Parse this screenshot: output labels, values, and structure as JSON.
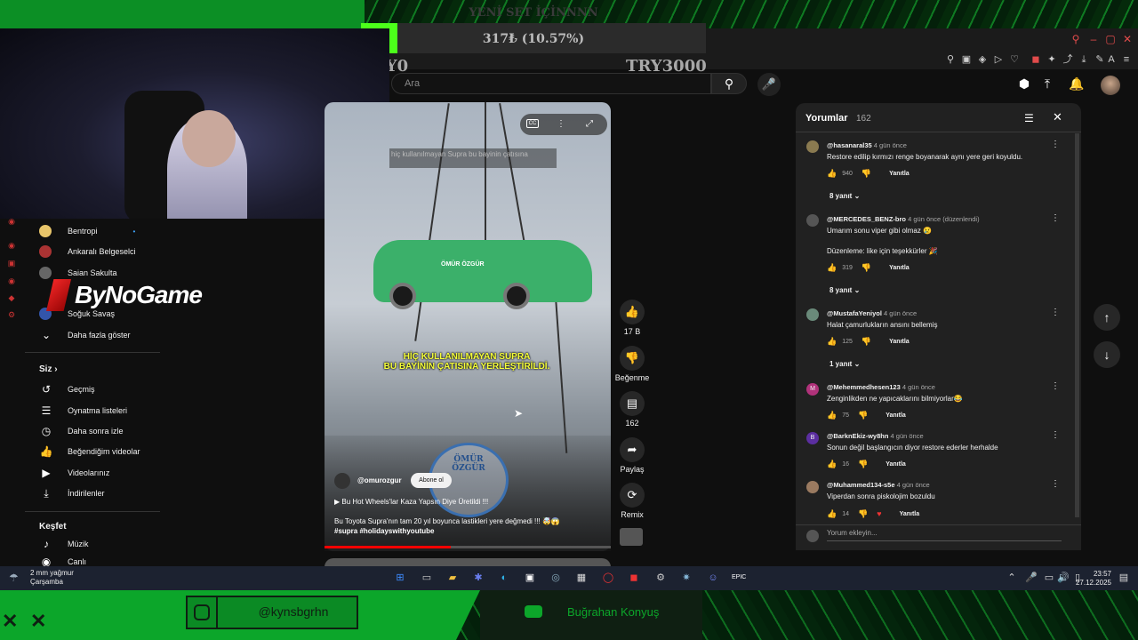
{
  "overlay": {
    "set_title": "YENİ SET İÇİNNNN",
    "donation_text": "317₺ (10.57%)",
    "donation_progress_percent": 10.57,
    "try_min": "TRY0",
    "try_max": "TRY3000",
    "instagram": "@kynsbgrhn",
    "youtube_name": "Buğrahan Konyuş",
    "logo": "ByNoGame"
  },
  "header": {
    "search_placeholder": "Ara"
  },
  "sidebar": {
    "subscriptions": [
      {
        "label": "Bentropi"
      },
      {
        "label": "Ankaralı Belgeselci"
      },
      {
        "label": "Saian Sakulta"
      },
      {
        "label": "Soğuk Savaş"
      }
    ],
    "show_more": "Daha fazla göster",
    "you_heading": "Siz",
    "you_items": [
      {
        "label": "Geçmiş",
        "icon": "history-icon"
      },
      {
        "label": "Oynatma listeleri",
        "icon": "playlist-icon"
      },
      {
        "label": "Daha sonra izle",
        "icon": "clock-icon"
      },
      {
        "label": "Beğendiğim videolar",
        "icon": "like-icon"
      },
      {
        "label": "Videolarınız",
        "icon": "video-icon"
      },
      {
        "label": "İndirilenler",
        "icon": "download-icon"
      }
    ],
    "explore_heading": "Keşfet",
    "explore_items": [
      {
        "label": "Müzik",
        "icon": "music-icon"
      },
      {
        "label": "Canlı",
        "icon": "live-icon"
      }
    ]
  },
  "video": {
    "caption_top": "hiç kullanılmayan Supra bu bayinin çatısına",
    "car_label": "ÖMÜR ÖZGÜR",
    "subtitle_line1": "HİÇ KULLANILMAYAN SUPRA",
    "subtitle_line2": "BU BAYİNİN ÇATISINA YERLEŞTİRİLDİ.",
    "channel_logo_text": "ÖMÜR ÖZGÜR",
    "channel": "@omurozgur",
    "subscribe": "Abone ol",
    "title": "▶ Bu Hot Wheels'lar Kaza Yapsın Diye Üretildi !!!",
    "description": "Bu Toyota Supra'nın tam 20 yıl boyunca lastikleri yere değmedi !!! 🤯😱",
    "hashtags": "#supra #holidayswithyoutube",
    "progress_percent": 44
  },
  "actions": {
    "likes": "17 B",
    "dislike": "Beğenme",
    "comments": "162",
    "share": "Paylaş",
    "remix": "Remix"
  },
  "comments": {
    "title": "Yorumlar",
    "count": "162",
    "input_placeholder": "Yorum ekleyin...",
    "items": [
      {
        "user": "@hasanaral35",
        "time": "4 gün önce",
        "text": "Restore edilip kırmızı renge boyanarak aynı yere geri koyuldu.",
        "likes": "940",
        "reply": "Yanıtla",
        "replies": "8 yanıt"
      },
      {
        "user": "@MERCEDES_BENZ-bro",
        "time": "4 gün önce (düzenlendi)",
        "text": "Umarım sonu viper gibi olmaz 😢",
        "text2": "Düzenleme: like için teşekkürler 🎉",
        "likes": "319",
        "reply": "Yanıtla",
        "replies": "8 yanıt"
      },
      {
        "user": "@MustafaYeniyol",
        "time": "4 gün önce",
        "text": "Halat çamurlukların ansını bellemiş",
        "likes": "125",
        "reply": "Yanıtla",
        "replies": "1 yanıt"
      },
      {
        "user": "@Mehemmedhesen123",
        "time": "4 gün önce",
        "text": "Zenginlikden ne yapıcaklarını bilmiyorlar😂",
        "likes": "75",
        "reply": "Yanıtla",
        "avatar_letter": "M"
      },
      {
        "user": "@BarknEkiz-wy8hn",
        "time": "4 gün önce",
        "text": "Sonun değil başlangıcın diyor restore ederler herhalde",
        "likes": "16",
        "reply": "Yanıtla",
        "avatar_letter": "B"
      },
      {
        "user": "@Muhammed134-s5e",
        "time": "4 gün önce",
        "text": "Viperdan sonra piskolojim bozuldu",
        "likes": "14",
        "reply": "Yanıtla"
      }
    ]
  },
  "taskbar": {
    "weather": "2 mm yağmur",
    "day": "Çarşamba",
    "time": "23:57",
    "date": "27.12.2025"
  },
  "colors": {
    "accent_green": "#0ca62a",
    "donation_fill": "#4cff1a",
    "yt_red": "#ff0000",
    "subtitle_yellow": "#f6ff3a"
  }
}
